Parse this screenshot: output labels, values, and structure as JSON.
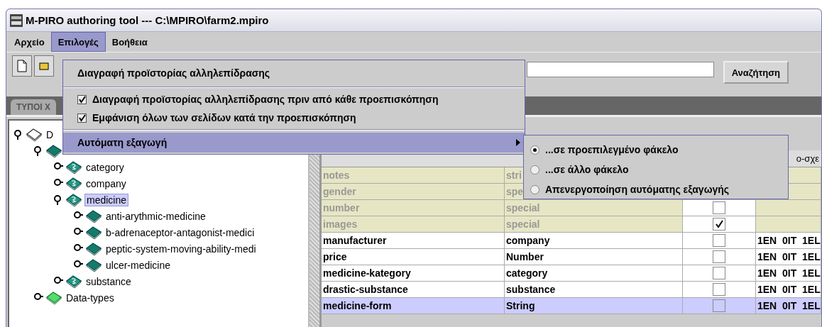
{
  "window": {
    "title": "M-PIRO authoring tool --- C:\\MPIRO\\farm2.mpiro"
  },
  "menu_bar": [
    {
      "label": "Αρχείο",
      "selected": false
    },
    {
      "label": "Επιλογές",
      "selected": true
    },
    {
      "label": "Βοήθεια",
      "selected": false
    }
  ],
  "options_menu": [
    {
      "kind": "command",
      "label": "Διαγραφή προϊστορίας αλληλεπίδρασης"
    },
    {
      "kind": "separator"
    },
    {
      "kind": "check",
      "label": "Διαγραφή προϊστορίας αλληλεπίδρασης πριν από κάθε προεπισκόπηση",
      "checked": true
    },
    {
      "kind": "check",
      "label": "Εμφάνιση όλων των σελίδων κατά την προεπισκόπηση",
      "checked": true
    },
    {
      "kind": "separator"
    },
    {
      "kind": "submenu",
      "label": "Αυτόματη εξαγωγή",
      "selected": true
    }
  ],
  "export_submenu": [
    {
      "label": "...σε προεπιλεγμένο φάκελο",
      "selected": true
    },
    {
      "label": "...σε άλλο φάκελο",
      "selected": false
    },
    {
      "label": "Απενεργοποίηση αυτόματης εξαγωγής",
      "selected": false
    }
  ],
  "search_button": "Αναζήτηση",
  "tabs": [
    {
      "label": "ΤΥΠΟΙ Χ",
      "selected": true
    }
  ],
  "tree": [
    {
      "kind": "white",
      "label": "D",
      "expanded": true,
      "selected": false,
      "children": [
        {
          "kind": "dark",
          "expanded": true,
          "children": [
            {
              "kind": "basic",
              "label": "category",
              "expanded": false,
              "selected": false
            },
            {
              "kind": "basic",
              "label": "company",
              "expanded": false,
              "selected": false
            },
            {
              "kind": "basic",
              "label": "medicine",
              "expanded": true,
              "selected": true,
              "children": [
                {
                  "kind": "dark",
                  "label": "anti-arythmic-medicine",
                  "expanded": false,
                  "selected": false
                },
                {
                  "kind": "dark",
                  "label": "b-adrenaceptor-antagonist-medici",
                  "expanded": false,
                  "selected": false
                },
                {
                  "kind": "dark",
                  "label": "peptic-system-moving-ability-medi",
                  "expanded": false,
                  "selected": false
                },
                {
                  "kind": "dark",
                  "label": "ulcer-medicine",
                  "expanded": false,
                  "selected": false
                }
              ]
            },
            {
              "kind": "basic",
              "label": "substance",
              "expanded": false,
              "selected": false
            }
          ]
        },
        {
          "kind": "light",
          "label": "Data-types",
          "expanded": false,
          "selected": false
        }
      ]
    }
  ],
  "table": {
    "header_fragment": "ο-σχε",
    "rows": [
      {
        "cells": [
          "notes",
          "stri"
        ],
        "inherited": true,
        "selected": false
      },
      {
        "cells": [
          "gender",
          "spe"
        ],
        "inherited": true,
        "selected": false
      },
      {
        "cells": [
          "number",
          "special"
        ],
        "inherited": true,
        "checked": false,
        "selected": false
      },
      {
        "cells": [
          "images",
          "special"
        ],
        "inherited": true,
        "checked": true,
        "selected": false
      },
      {
        "cells": [
          "manufacturer",
          "company",
          "1EN  0IT  1EL"
        ],
        "inherited": false,
        "checked": false,
        "selected": false
      },
      {
        "cells": [
          "price",
          "Number",
          "1EN  0IT  1EL"
        ],
        "inherited": false,
        "checked": false,
        "selected": false
      },
      {
        "cells": [
          "medicine-kategory",
          "category",
          "1EN  0IT  1EL"
        ],
        "inherited": false,
        "checked": false,
        "selected": false
      },
      {
        "cells": [
          "drastic-substance",
          "substance",
          "1EN  0IT  1EL"
        ],
        "inherited": false,
        "checked": false,
        "selected": false
      },
      {
        "cells": [
          "medicine-form",
          "String",
          "1EN  0IT  1EL"
        ],
        "inherited": false,
        "checked": false,
        "selected": true
      }
    ]
  }
}
